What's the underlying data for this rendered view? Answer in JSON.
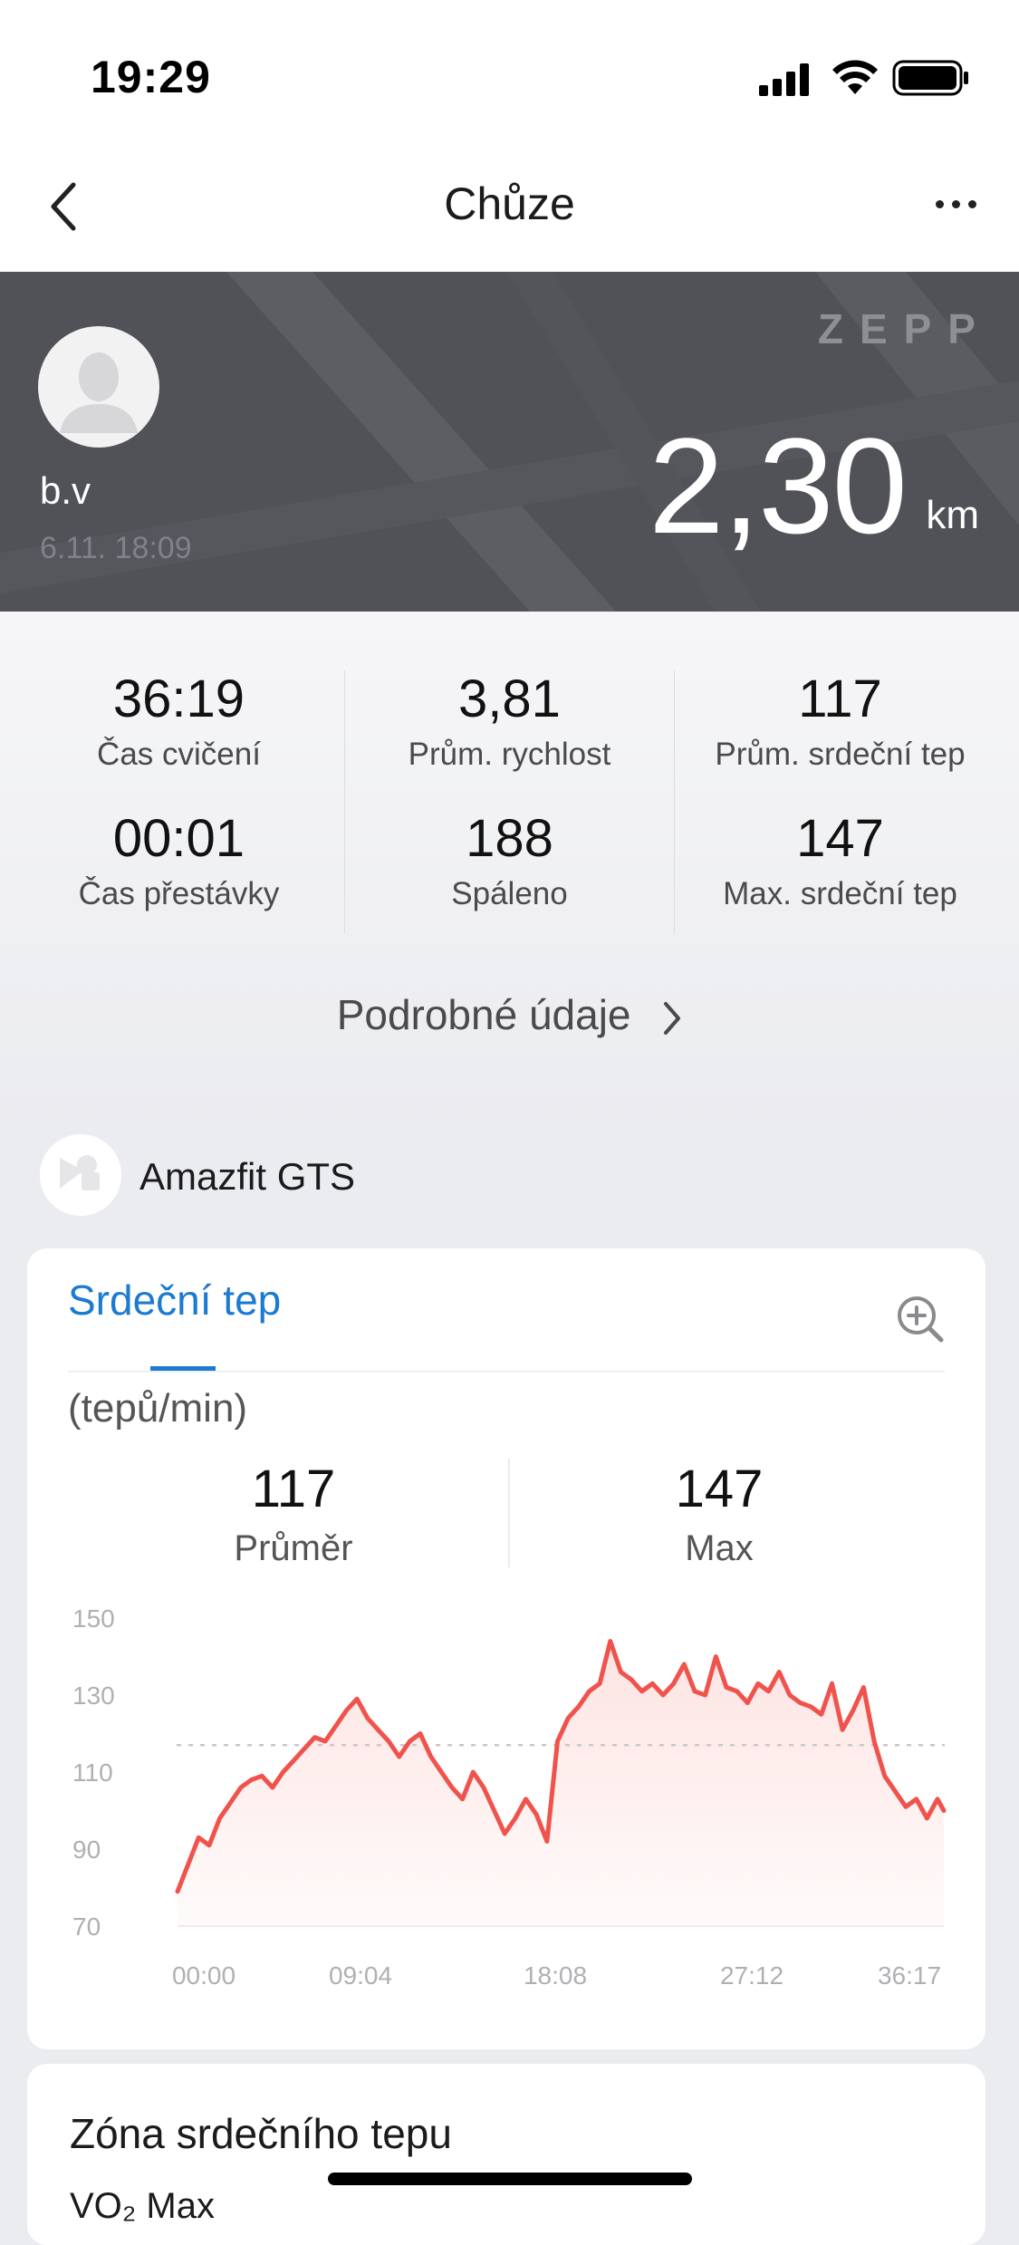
{
  "status_bar": {
    "time": "19:29"
  },
  "nav": {
    "title": "Chůze"
  },
  "hero": {
    "brand": "ZEPP",
    "user_name": "b.v",
    "date_time": "6.11. 18:09",
    "distance_value": "2,30",
    "distance_unit": "km"
  },
  "summary": {
    "stats": [
      {
        "value": "36:19",
        "label": "Čas cvičení"
      },
      {
        "value": "3,81",
        "label": "Prům. rychlost"
      },
      {
        "value": "117",
        "label": "Prům. srdeční tep"
      },
      {
        "value": "00:01",
        "label": "Čas přestávky"
      },
      {
        "value": "188",
        "label": "Spáleno"
      },
      {
        "value": "147",
        "label": "Max. srdeční tep"
      }
    ],
    "details_link": "Podrobné údaje"
  },
  "device": {
    "name": "Amazfit GTS"
  },
  "heart_rate_card": {
    "tab_label": "Srdeční tep",
    "unit": "(tepů/min)",
    "average_value": "117",
    "average_label": "Průměr",
    "max_value": "147",
    "max_label": "Max"
  },
  "chart_data": {
    "type": "area",
    "title": "",
    "xlabel": "",
    "ylabel": "(tepů/min)",
    "ylim": [
      70,
      150
    ],
    "yticks": [
      "150",
      "130",
      "110",
      "90",
      "70"
    ],
    "xticks": [
      "00:00",
      "09:04",
      "18:08",
      "27:12",
      "36:17"
    ],
    "average_line": 117,
    "grid": false,
    "colors": {
      "line": "#f0524c",
      "fill": "#fde4e2",
      "average": "#c8c8cc"
    },
    "series": [
      {
        "x": [
          0,
          0.5,
          1,
          1.5,
          2,
          2.5,
          3,
          3.5,
          4,
          4.5,
          5,
          5.5,
          6,
          6.5,
          7,
          7.5,
          8,
          8.5,
          9,
          9.5,
          10,
          10.5,
          11,
          11.5,
          12,
          12.5,
          13,
          13.5,
          14,
          14.5,
          15,
          15.5,
          16,
          16.5,
          17,
          17.5,
          18,
          18.5,
          19,
          19.5,
          20,
          20.5,
          21,
          21.5,
          22,
          22.5,
          23,
          23.5,
          24,
          24.5,
          25,
          25.5,
          26,
          26.5,
          27,
          27.5,
          28,
          28.5,
          29,
          29.5,
          30,
          30.5,
          31,
          31.5,
          32,
          32.5,
          33,
          33.5,
          34,
          34.5,
          35,
          35.5,
          36,
          36.3
        ],
        "values": [
          79,
          86,
          93,
          91,
          98,
          102,
          106,
          108,
          109,
          106,
          110,
          113,
          116,
          119,
          118,
          122,
          126,
          129,
          124,
          121,
          118,
          114,
          118,
          120,
          114,
          110,
          106,
          103,
          110,
          106,
          100,
          94,
          98,
          103,
          99,
          92,
          118,
          124,
          127,
          131,
          133,
          144,
          136,
          134,
          131,
          133,
          130,
          133,
          138,
          131,
          130,
          140,
          132,
          131,
          128,
          133,
          131,
          136,
          130,
          128,
          127,
          125,
          133,
          121,
          126,
          132,
          118,
          109,
          105,
          101,
          103,
          98,
          103,
          100
        ]
      }
    ]
  },
  "zone_card": {
    "title": "Zóna srdečního tepu",
    "subtitle": "VO₂ Max"
  }
}
